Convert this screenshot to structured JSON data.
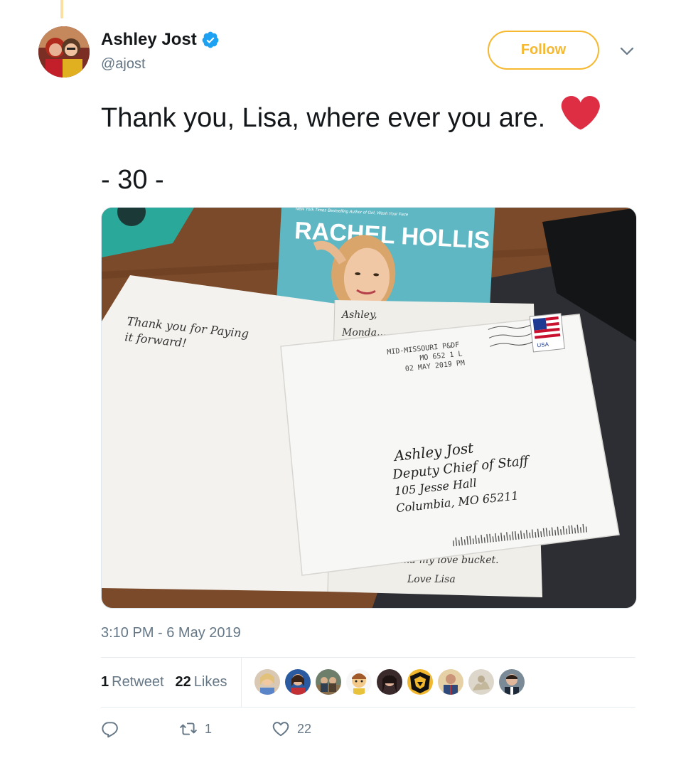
{
  "tweet": {
    "author_name": "Ashley Jost",
    "handle": "@ajost",
    "follow_label": "Follow",
    "text": "Thank you, Lisa, where ever you are.",
    "emoji": "red-heart",
    "subtext": "- 30 -",
    "timestamp": "3:10 PM - 6 May 2019"
  },
  "stats": {
    "retweet_count": "1",
    "retweet_label": "Retweet",
    "like_count": "22",
    "like_label": "Likes"
  },
  "actions": {
    "reply_count": "",
    "retweet_count": "1",
    "like_count": "22"
  },
  "photo": {
    "book_author": "RACHEL HOLLIS",
    "book_tagline": "New York Times Bestselling Author of Girl, Wash Your Face",
    "card_left_line1": "Thank you for Paying",
    "card_left_line2": "it forward!",
    "card_right_top1": "Ashley,",
    "card_right_top2": "Monda...",
    "card_right_bottom1": "...d my love bucket.",
    "card_right_bottom2": "Love Lisa",
    "postmark_line1": "MID-MISSOURI P&DF",
    "postmark_line2": "MO 652  1 L",
    "postmark_line3": "02 MAY 2019  PM",
    "stamp_text": "USA",
    "address_line1": "Ashley Jost",
    "address_line2": "Deputy Chief of Staff",
    "address_line3": "105 Jesse Hall",
    "address_line4": "Columbia, MO 65211"
  },
  "colors": {
    "accent": "#f5b82e",
    "verified": "#1da1f2",
    "heart": "#e0245e",
    "muted": "#657786"
  }
}
